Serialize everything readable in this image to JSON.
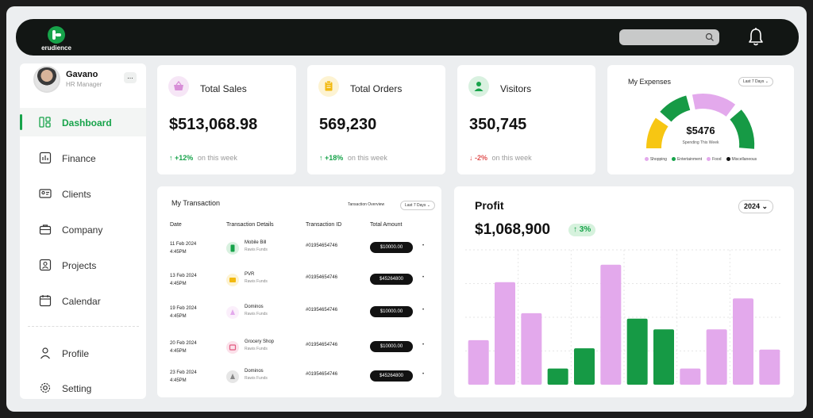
{
  "app": {
    "name": "erudience"
  },
  "user": {
    "name": "Gavano",
    "role": "HR Manager",
    "more_label": "..."
  },
  "sidebar": {
    "items": [
      {
        "label": "Dashboard",
        "icon": "dashboard-icon",
        "active": true
      },
      {
        "label": "Finance",
        "icon": "finance-icon"
      },
      {
        "label": "Clients",
        "icon": "clients-icon"
      },
      {
        "label": "Company",
        "icon": "company-icon"
      },
      {
        "label": "Projects",
        "icon": "projects-icon"
      },
      {
        "label": "Calendar",
        "icon": "calendar-icon"
      }
    ],
    "bottom_items": [
      {
        "label": "Profile",
        "icon": "profile-icon"
      },
      {
        "label": "Setting",
        "icon": "setting-icon"
      }
    ]
  },
  "stats": [
    {
      "label": "Total Sales",
      "value": "$513,068.98",
      "change": "+12%",
      "change_suffix": "on this week",
      "direction": "up",
      "icon": "basket-icon",
      "icon_color": "#d88fd8",
      "icon_bg": "#f6e6f6"
    },
    {
      "label": "Total Orders",
      "value": "569,230",
      "change": "+18%",
      "change_suffix": "on this week",
      "direction": "up",
      "icon": "clipboard-icon",
      "icon_color": "#f2b90f",
      "icon_bg": "#fdf3d2"
    },
    {
      "label": "Visitors",
      "value": "350,745",
      "change": "-2%",
      "change_suffix": "on this week",
      "direction": "down",
      "icon": "user-icon",
      "icon_color": "#17a34a",
      "icon_bg": "#d9f1e0"
    }
  ],
  "expenses": {
    "title": "My Expenses",
    "period": "Last 7 Days",
    "total": "$5476",
    "caption": "Spending This Week",
    "legend": [
      {
        "label": "Shopping",
        "color": "#e3a9ec"
      },
      {
        "label": "Entertainment",
        "color": "#17a34a"
      },
      {
        "label": "Food",
        "color": "#e3a9ec"
      },
      {
        "label": "Miscellaneous",
        "color": "#121212"
      }
    ],
    "segments": [
      {
        "color": "#f7c613"
      },
      {
        "color": "#169a45"
      },
      {
        "color": "#e3a9ec"
      },
      {
        "color": "#169a45"
      }
    ]
  },
  "transactions": {
    "title": "My Transaction",
    "overview_label": "Tansaction Overview",
    "period": "Last 7 Days",
    "columns": [
      "Date",
      "Transaction Details",
      "Transaction ID",
      "Total Amount"
    ],
    "rows": [
      {
        "date": "11 Feb 2024",
        "time": "4:45PM",
        "name": "Mobile Bill",
        "source": "Rawis Funds",
        "id": "#01954654746",
        "amount": "$10000.00",
        "icon": "mobile-icon",
        "icon_bg": "#d9f1e0",
        "icon_color": "#17a34a"
      },
      {
        "date": "13 Feb 2024",
        "time": "4:45PM",
        "name": "PVR",
        "source": "Rawis Funds",
        "id": "#01954654746",
        "amount": "$45264800",
        "icon": "ticket-icon",
        "icon_bg": "#fdf3d2",
        "icon_color": "#f2b90f"
      },
      {
        "date": "19 Feb 2024",
        "time": "4:45PM",
        "name": "Dominos",
        "source": "Rawis Funds",
        "id": "#01954654746",
        "amount": "$10000.00",
        "icon": "pizza-icon",
        "icon_bg": "#fbeffb",
        "icon_color": "#e3a9ec"
      },
      {
        "date": "20 Feb 2024",
        "time": "4:45PM",
        "name": "Grocery Shop",
        "source": "Rawis Funds",
        "id": "#01954654746",
        "amount": "$10000.00",
        "icon": "cart-icon",
        "icon_bg": "#fbe1ea",
        "icon_color": "#e2587f"
      },
      {
        "date": "23 Feb 2024",
        "time": "4:45PM",
        "name": "Dominos",
        "source": "Rawis Funds",
        "id": "#01954654746",
        "amount": "$45264800",
        "icon": "pizza-icon",
        "icon_bg": "#e6e6e6",
        "icon_color": "#888888"
      }
    ]
  },
  "profit": {
    "title": "Profit",
    "value": "$1,068,900",
    "change": "↑ 3%",
    "year": "2024",
    "colors": {
      "pink": "#e3a9ec",
      "green": "#169a45"
    }
  },
  "chart_data": {
    "type": "bar",
    "ylim": [
      0,
      100
    ],
    "values": [
      33,
      76,
      53,
      12,
      27,
      89,
      49,
      41,
      12,
      41,
      64,
      26
    ],
    "bar_colors": [
      "pink",
      "pink",
      "pink",
      "green",
      "green",
      "pink",
      "green",
      "green",
      "pink",
      "pink",
      "pink",
      "pink"
    ],
    "grid": true
  }
}
